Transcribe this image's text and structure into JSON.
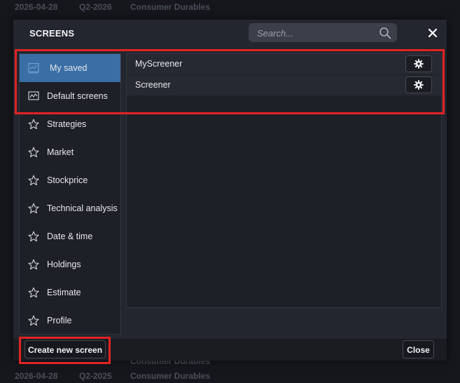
{
  "background_rows": [
    {
      "date": "2026-04-28",
      "quarter": "Q2-2026",
      "sector": "Consumer Durables"
    },
    {
      "date": "",
      "quarter": "",
      "sector": "Consumer Durables"
    },
    {
      "date": "2026-04-28",
      "quarter": "Q2-2025",
      "sector": "Consumer Durables"
    }
  ],
  "modal": {
    "title": "SCREENS",
    "search_placeholder": "Search..."
  },
  "sidebar": {
    "items": [
      {
        "label": "My saved",
        "icon": "checkbox-chart-icon",
        "active": true
      },
      {
        "label": "Default screens",
        "icon": "line-chart-icon",
        "active": false
      },
      {
        "label": "Strategies",
        "icon": "star-icon",
        "active": false
      },
      {
        "label": "Market",
        "icon": "star-icon",
        "active": false
      },
      {
        "label": "Stockprice",
        "icon": "star-icon",
        "active": false
      },
      {
        "label": "Technical analysis",
        "icon": "star-icon",
        "active": false
      },
      {
        "label": "Date & time",
        "icon": "star-icon",
        "active": false
      },
      {
        "label": "Holdings",
        "icon": "star-icon",
        "active": false
      },
      {
        "label": "Estimate",
        "icon": "star-icon",
        "active": false
      },
      {
        "label": "Profile",
        "icon": "star-icon",
        "active": false
      }
    ]
  },
  "screens": [
    {
      "name": "MyScreener"
    },
    {
      "name": "Screener"
    }
  ],
  "footer": {
    "create_label": "Create new screen",
    "close_label": "Close"
  },
  "colors": {
    "accent_active": "#3a6ea5",
    "highlight_red": "#e02424"
  }
}
